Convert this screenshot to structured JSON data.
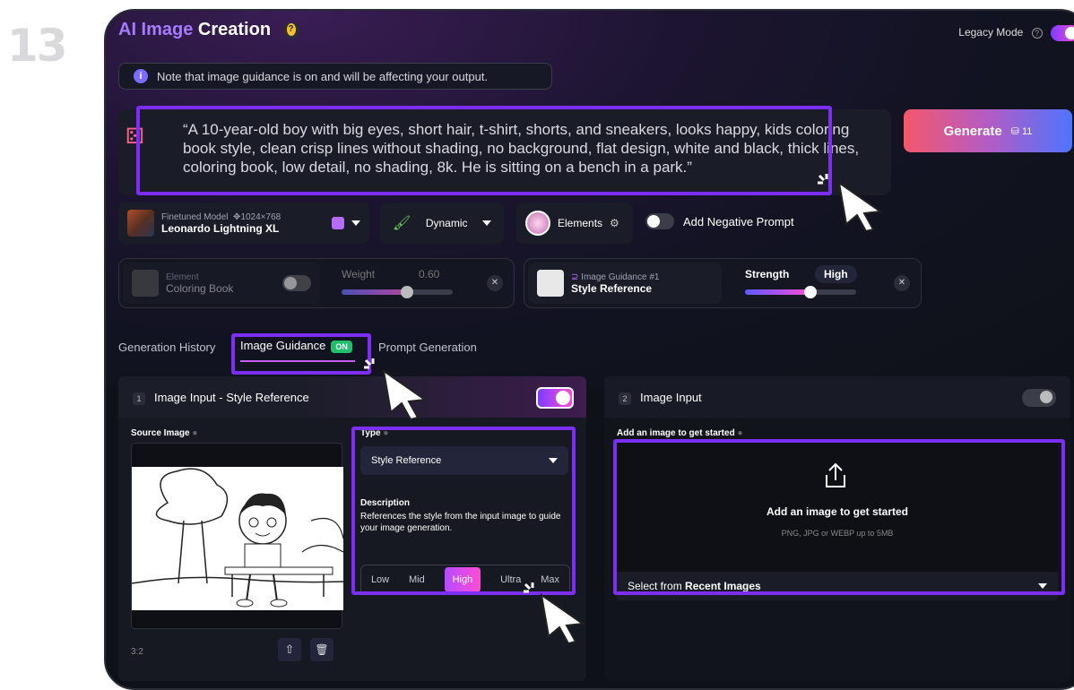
{
  "step_number": "13",
  "header": {
    "title_ai": "AI Image",
    "title_rest": " Creation",
    "legacy_label": "Legacy Mode"
  },
  "note": {
    "text": "Note that image guidance is on and will be affecting your output."
  },
  "prompt": {
    "text": "“A 10-year-old boy with big eyes, short hair, t-shirt, shorts, and sneakers, looks happy, kids coloring book style, clean crisp lines without shading, no background, flat design, white and black, thick lines, coloring book, low detail, no shading, 8k. He is sitting on a bench in a park.”"
  },
  "generate": {
    "label": "Generate",
    "count": "11"
  },
  "model": {
    "label": "Finetuned Model",
    "size": "1024×768",
    "name": "Leonardo Lightning XL"
  },
  "style_preset": {
    "label": "Dynamic"
  },
  "elements": {
    "label": "Elements"
  },
  "negative_prompt": {
    "label": "Add Negative Prompt"
  },
  "element_card": {
    "label": "Element",
    "name": "Coloring Book",
    "weight_label": "Weight",
    "weight_value": "0.60",
    "weight": 0.6
  },
  "guidance_card": {
    "label": "Image Guidance #1",
    "name": "Style Reference",
    "strength_label": "Strength",
    "strength_value": "High",
    "strength": 0.6
  },
  "tabs": {
    "history": "Generation History",
    "guidance": "Image Guidance",
    "guidance_badge": "ON",
    "prompt_gen": "Prompt Generation"
  },
  "panel1": {
    "num": "1",
    "title": "Image Input - Style Reference",
    "source_label": "Source Image",
    "type_label": "Type",
    "type_value": "Style Reference",
    "desc_title": "Description",
    "desc_text": "References the style from the input image to guide your image generation.",
    "ratio": "3:2",
    "levels": [
      "Low",
      "Mid",
      "High",
      "Ultra",
      "Max"
    ],
    "active_level": "High"
  },
  "panel2": {
    "num": "2",
    "title": "Image Input",
    "add_label": "Add an image to get started",
    "drop_title": "Add an image to get started",
    "drop_sub": "PNG, JPG or WEBP up to 5MB",
    "select_prefix": "Select from ",
    "select_bold": "Recent Images"
  },
  "colors": {
    "accent": "#7c2ff2",
    "badge_on": "#1fbf6b"
  }
}
